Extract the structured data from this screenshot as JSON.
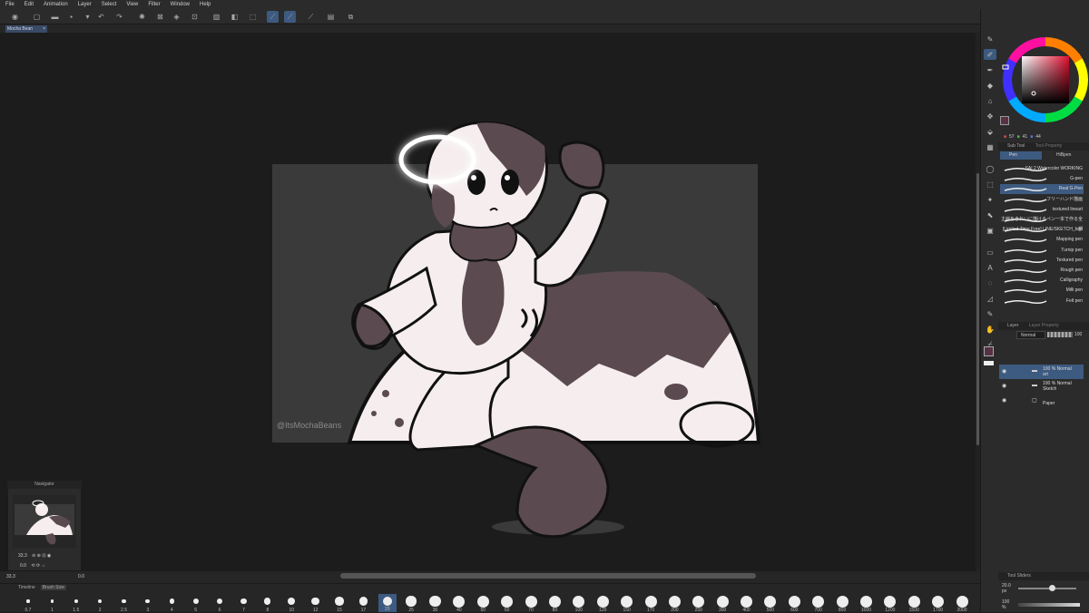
{
  "menu": [
    "File",
    "Edit",
    "Animation",
    "Layer",
    "Select",
    "View",
    "Filter",
    "Window",
    "Help"
  ],
  "document_tab": "Mocha Bean",
  "canvas_watermark": "@ItsMochaBeans",
  "view": {
    "zoom": "33.3",
    "angle": "0.0"
  },
  "navigator": {
    "title": "Navigator",
    "zoom": "33.3",
    "angle": "0.0"
  },
  "brush_size_tabs": [
    "Timeline",
    "Brush Size"
  ],
  "brush_sizes": [
    "0.7",
    "1",
    "1.5",
    "2",
    "2.5",
    "3",
    "4",
    "5",
    "6",
    "7",
    "8",
    "10",
    "12",
    "15",
    "17",
    "20",
    "25",
    "30",
    "40",
    "50",
    "60",
    "70",
    "80",
    "100",
    "120",
    "150",
    "170",
    "200",
    "250",
    "300",
    "400",
    "500",
    "600",
    "700",
    "800",
    "1000",
    "1200",
    "1500",
    "1700",
    "2000"
  ],
  "selected_brush_size": "20",
  "color": {
    "main": "#573244",
    "rgb": {
      "r": "57",
      "g": "41",
      "b": "44"
    }
  },
  "subtool": {
    "panel_title": "Sub Tool",
    "panel_title_2": "Tool Property",
    "tabs": [
      "Pen",
      "HiBpen"
    ],
    "brushes": [
      "SAI 2 Watercolor WORKING",
      "G-pen",
      "Real G-Pen",
      "フリーハンド描画",
      "textured lineart",
      "主線をきれいに描けるペン一本で作る全部",
      "[Limited Time Free] LINE/SKETCH_bun",
      "Mapping pen",
      "Turnip pen",
      "Textured pen",
      "Rough pen",
      "Calligraphy",
      "Milli pen",
      "Felt pen"
    ],
    "selected_index": 2
  },
  "layer_panel": {
    "title": "Layer",
    "title_2": "Layer Property",
    "blend_mode": "Normal",
    "opacity": "100",
    "layers": [
      {
        "opacity_mode": "100 % Normal",
        "name": "art"
      },
      {
        "opacity_mode": "100 % Normal",
        "name": "Sketch"
      },
      {
        "opacity_mode": "",
        "name": "Paper"
      }
    ],
    "selected_index": 0
  },
  "tool_sliders": {
    "title": "Tool Sliders",
    "size": "20.0",
    "size_unit": "px",
    "opacity": "100",
    "opacity_unit": "%"
  }
}
